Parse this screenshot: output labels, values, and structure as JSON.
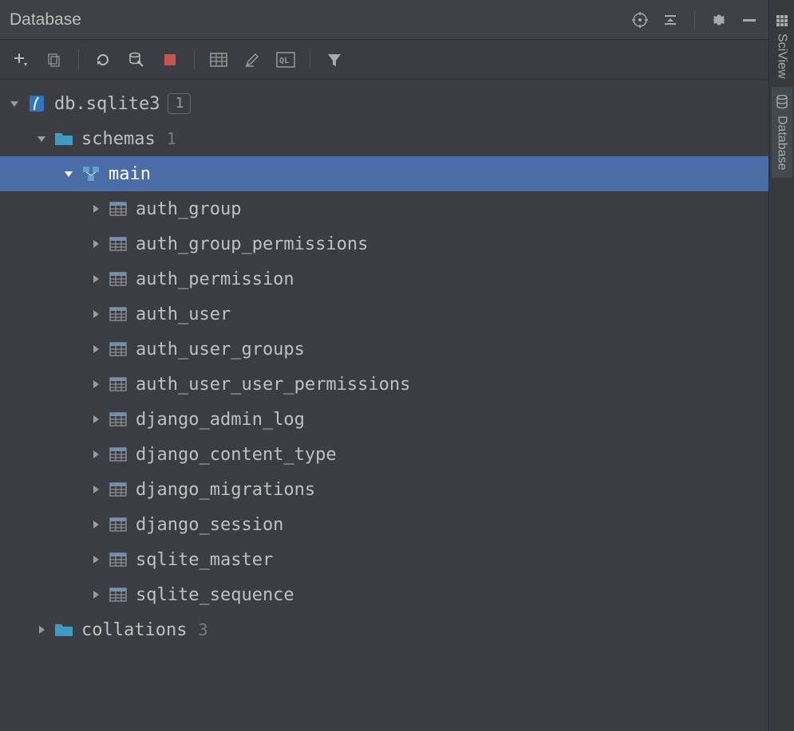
{
  "panel": {
    "title": "Database"
  },
  "side_tabs": {
    "sciview": "SciView",
    "database": "Database"
  },
  "tree": {
    "db": {
      "name": "db.sqlite3",
      "badge": "1"
    },
    "schemas": {
      "name": "schemas",
      "count": "1"
    },
    "main_schema": {
      "name": "main"
    },
    "tables": [
      {
        "name": "auth_group"
      },
      {
        "name": "auth_group_permissions"
      },
      {
        "name": "auth_permission"
      },
      {
        "name": "auth_user"
      },
      {
        "name": "auth_user_groups"
      },
      {
        "name": "auth_user_user_permissions"
      },
      {
        "name": "django_admin_log"
      },
      {
        "name": "django_content_type"
      },
      {
        "name": "django_migrations"
      },
      {
        "name": "django_session"
      },
      {
        "name": "sqlite_master"
      },
      {
        "name": "sqlite_sequence"
      }
    ],
    "collations": {
      "name": "collations",
      "count": "3"
    }
  }
}
